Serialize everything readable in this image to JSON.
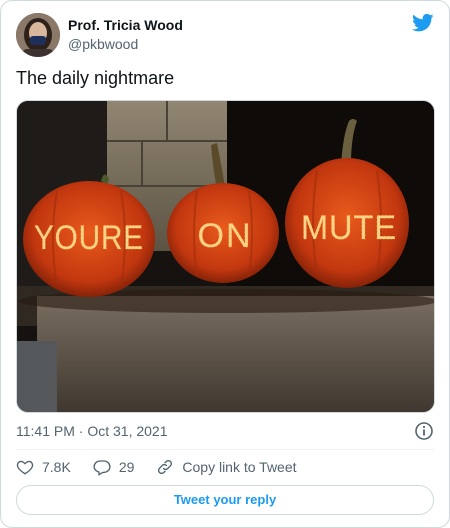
{
  "author": {
    "display_name": "Prof. Tricia Wood",
    "handle": "@pkbwood"
  },
  "tweet": {
    "text": "The daily nightmare",
    "timestamp": "11:41 PM · Oct 31, 2021"
  },
  "photo": {
    "pumpkin_words": [
      "YOURE",
      "ON",
      "MUTE"
    ]
  },
  "actions": {
    "likes": "7.8K",
    "replies": "29",
    "copy_link": "Copy link to Tweet"
  },
  "reply_button": "Tweet your reply",
  "colors": {
    "accent": "#1d9bf0",
    "like": "#536471",
    "border": "#cfd9de"
  },
  "icons": [
    "twitter-bird-icon",
    "info-icon",
    "heart-icon",
    "reply-icon",
    "link-icon"
  ]
}
